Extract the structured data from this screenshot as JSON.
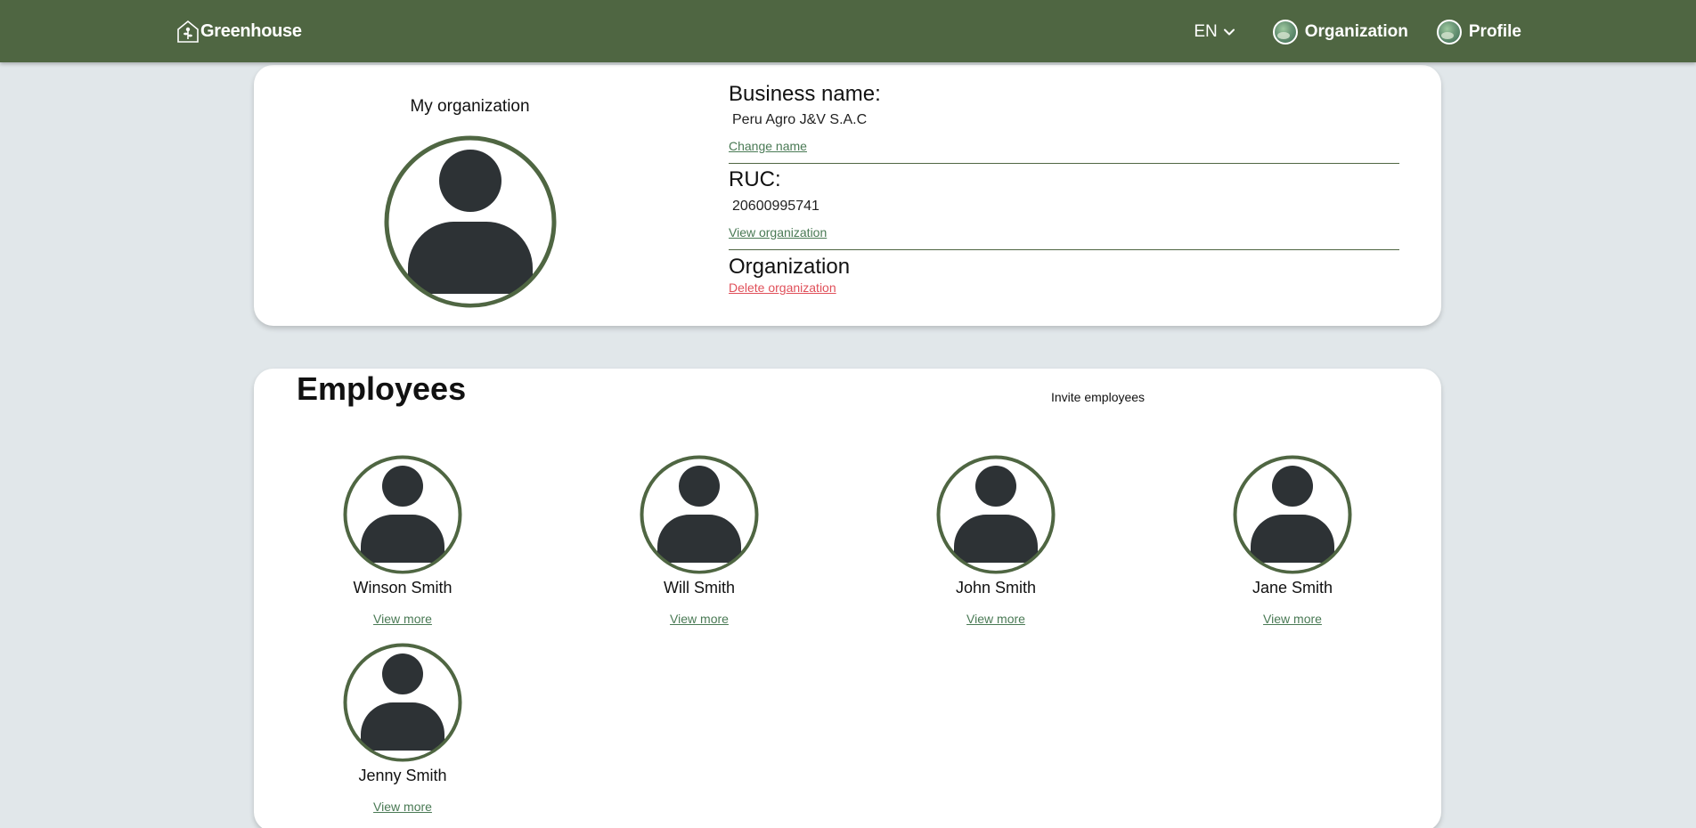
{
  "nav": {
    "brand": "Greenhouse",
    "language": "EN",
    "organization_label": "Organization",
    "profile_label": "Profile"
  },
  "organization_card": {
    "title": "My organization",
    "business_name_label": "Business name:",
    "business_name_value": "Peru Agro J&V S.A.C",
    "change_name_link": "Change name",
    "ruc_label": "RUC:",
    "ruc_value": "20600995741",
    "view_organization_link": "View organization",
    "organization_label": "Organization",
    "delete_link": "Delete organization"
  },
  "employees": {
    "title": "Employees",
    "invite_label": "Invite employees",
    "view_more_label": "View more",
    "list": [
      {
        "name": "Winson Smith"
      },
      {
        "name": "Will Smith"
      },
      {
        "name": "John Smith"
      },
      {
        "name": "Jane Smith"
      },
      {
        "name": "Jenny Smith"
      }
    ]
  },
  "colors": {
    "navbar": "#4f6642",
    "avatar_ring": "#4f6642",
    "avatar_fill": "#2d3235",
    "link": "#4a7a55",
    "danger": "#e0505a",
    "page_bg": "#e1e7ea"
  }
}
